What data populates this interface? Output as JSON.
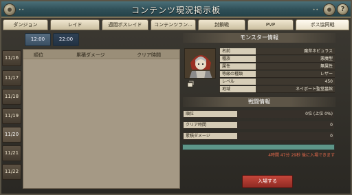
{
  "window": {
    "title": "コンテンツ現況掲示板",
    "dots_left": "••",
    "dots_right": "••",
    "help": "?"
  },
  "tabs": [
    "ダンジョン",
    "レイド",
    "週間ボスレイド",
    "コンテンツラン...",
    "封鎖戦",
    "PVP",
    "ボス協同戦"
  ],
  "times": [
    "12:00",
    "22:00"
  ],
  "dates": [
    "11/16",
    "11/17",
    "11/18",
    "11/19",
    "11/20",
    "11/21",
    "11/22"
  ],
  "ranking": {
    "col_rank": "順位",
    "col_damage": "累積ダメージ",
    "col_time": "クリア時間"
  },
  "monster": {
    "header": "モンスター情報",
    "rows": [
      {
        "label": "名前",
        "value": "魔斧ネビュラス"
      },
      {
        "label": "種族",
        "value": "悪魔型"
      },
      {
        "label": "属性",
        "value": "無属性"
      },
      {
        "label": "等級の種類",
        "value": "レザー"
      },
      {
        "label": "レベル",
        "value": "450"
      },
      {
        "label": "地域",
        "value": "ネイボート聖堂墓館"
      }
    ]
  },
  "battle": {
    "header": "戦闘情報",
    "rows": [
      {
        "label": "順位",
        "value": "0位 (上位 0%)"
      },
      {
        "label": "クリア時間",
        "value": "0"
      },
      {
        "label": "累積ダメージ",
        "value": "0"
      }
    ],
    "progress": 1.0,
    "note": "4時間 47分 29秒 後に入場できます"
  },
  "enter_button": "入場する",
  "colors": {
    "title_bar": "#2f4f57",
    "accent_red": "#c4463a",
    "progress": "#5d9689"
  }
}
